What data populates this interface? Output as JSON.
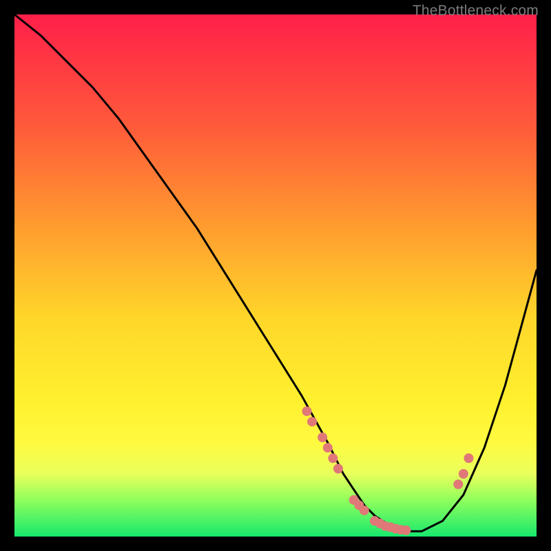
{
  "watermark": "TheBottleneck.com",
  "chart_data": {
    "type": "line",
    "title": "",
    "xlabel": "",
    "ylabel": "",
    "xlim": [
      0,
      100
    ],
    "ylim": [
      0,
      100
    ],
    "curve": {
      "x": [
        0,
        5,
        10,
        15,
        20,
        25,
        30,
        35,
        40,
        45,
        50,
        55,
        60,
        63,
        65,
        67,
        69,
        72,
        75,
        78,
        82,
        86,
        90,
        94,
        97,
        100
      ],
      "y": [
        100,
        96,
        91,
        86,
        80,
        73,
        66,
        59,
        51,
        43,
        35,
        27,
        18,
        12,
        9,
        6,
        4,
        2,
        1,
        1,
        3,
        8,
        17,
        29,
        40,
        51
      ]
    },
    "markers": {
      "x": [
        56,
        57,
        59,
        60,
        61,
        62,
        65,
        66,
        67,
        69,
        70,
        71,
        72,
        73,
        74,
        75,
        85,
        86,
        87
      ],
      "y": [
        24,
        22,
        19,
        17,
        15,
        13,
        7,
        6,
        5,
        3,
        2.5,
        2,
        1.8,
        1.5,
        1.3,
        1.2,
        10,
        12,
        15
      ]
    },
    "colors": {
      "curve": "#000000",
      "marker": "#e07878"
    }
  }
}
